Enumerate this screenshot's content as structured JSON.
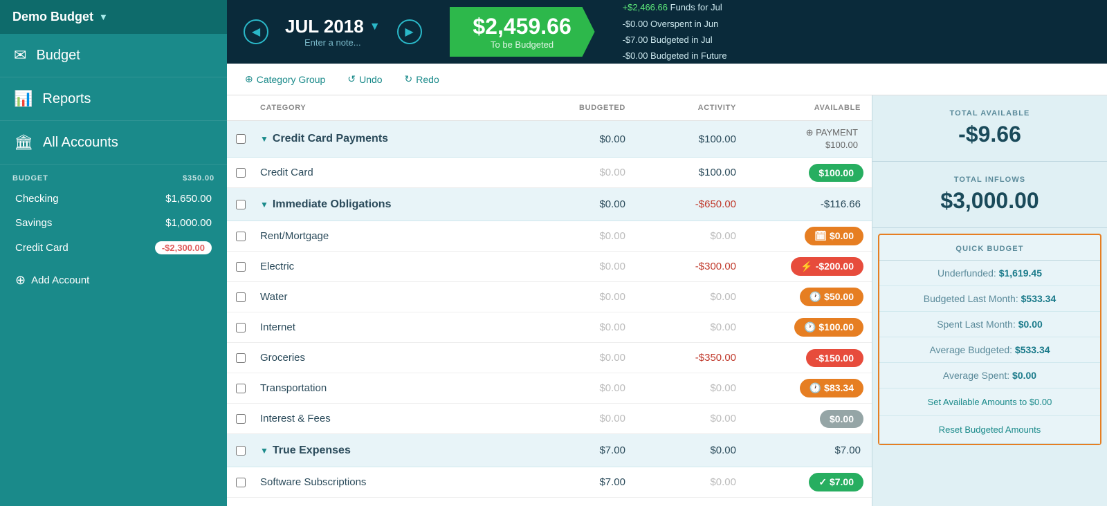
{
  "app": {
    "title": "Demo Budget",
    "title_arrow": "▼"
  },
  "sidebar": {
    "nav_items": [
      {
        "id": "budget",
        "icon": "✉",
        "label": "Budget"
      },
      {
        "id": "reports",
        "icon": "📊",
        "label": "Reports"
      },
      {
        "id": "all-accounts",
        "icon": "🏛",
        "label": "All Accounts"
      }
    ],
    "section_label": "BUDGET",
    "section_amount": "$350.00",
    "accounts": [
      {
        "name": "Checking",
        "amount": "$1,650.00",
        "negative": false
      },
      {
        "name": "Savings",
        "amount": "$1,000.00",
        "negative": false
      },
      {
        "name": "Credit Card",
        "amount": "-$2,300.00",
        "negative": true
      }
    ],
    "add_account_label": "Add Account"
  },
  "topbar": {
    "prev_label": "◀",
    "next_label": "▶",
    "month": "JUL 2018",
    "month_arrow": "▼",
    "month_note": "Enter a note...",
    "budget_value": "$2,459.66",
    "budget_label": "To be Budgeted",
    "info_lines": [
      {
        "prefix": "+",
        "amount": "$2,466.66",
        "label": "Funds for Jul"
      },
      {
        "prefix": "-",
        "amount": "$0.00",
        "label": "Overspent in Jun"
      },
      {
        "prefix": "-",
        "amount": "$7.00",
        "label": "Budgeted in Jul"
      },
      {
        "prefix": "-",
        "amount": "$0.00",
        "label": "Budgeted in Future"
      }
    ]
  },
  "toolbar": {
    "category_group_label": "Category Group",
    "undo_label": "Undo",
    "redo_label": "Redo"
  },
  "table": {
    "headers": [
      "CATEGORY",
      "BUDGETED",
      "ACTIVITY",
      "AVAILABLE"
    ],
    "groups": [
      {
        "id": "credit-card-payments",
        "name": "Credit Card Payments",
        "budgeted": "$0.00",
        "activity": "$100.00",
        "available_type": "payment",
        "available_label": "⊕ PAYMENT\n$100.00",
        "payment_line1": "⊕ PAYMENT",
        "payment_line2": "$100.00",
        "items": [
          {
            "name": "Credit Card",
            "budgeted": "$0.00",
            "activity": "$100.00",
            "available": "$100.00",
            "badge_color": "green"
          }
        ]
      },
      {
        "id": "immediate-obligations",
        "name": "Immediate Obligations",
        "budgeted": "$0.00",
        "activity": "-$650.00",
        "available": "-$116.66",
        "available_type": "text",
        "items": [
          {
            "name": "Rent/Mortgage",
            "budgeted": "$0.00",
            "activity": "$0.00",
            "available": "🗓 $0.00",
            "available_raw": "$0.00",
            "badge_color": "orange",
            "badge_icon": "🗓"
          },
          {
            "name": "Electric",
            "budgeted": "$0.00",
            "activity": "-$300.00",
            "available": "-$200.00",
            "badge_color": "red",
            "badge_icon": "⚡"
          },
          {
            "name": "Water",
            "budgeted": "$0.00",
            "activity": "$0.00",
            "available": "$50.00",
            "badge_color": "orange",
            "badge_icon": "🕐"
          },
          {
            "name": "Internet",
            "budgeted": "$0.00",
            "activity": "$0.00",
            "available": "$100.00",
            "badge_color": "orange",
            "badge_icon": "🕐"
          },
          {
            "name": "Groceries",
            "budgeted": "$0.00",
            "activity": "-$350.00",
            "available": "-$150.00",
            "badge_color": "red"
          },
          {
            "name": "Transportation",
            "budgeted": "$0.00",
            "activity": "$0.00",
            "available": "$83.34",
            "badge_color": "orange",
            "badge_icon": "🕐"
          },
          {
            "name": "Interest & Fees",
            "budgeted": "$0.00",
            "activity": "$0.00",
            "available": "$0.00",
            "badge_color": "gray"
          }
        ]
      },
      {
        "id": "true-expenses",
        "name": "True Expenses",
        "budgeted": "$7.00",
        "activity": "$0.00",
        "available": "$7.00",
        "available_type": "text",
        "items": [
          {
            "name": "Software Subscriptions",
            "budgeted": "$7.00",
            "activity": "$0.00",
            "available": "$7.00",
            "badge_color": "green",
            "badge_icon": "✓"
          }
        ]
      }
    ]
  },
  "right_panel": {
    "total_available_label": "TOTAL AVAILABLE",
    "total_available_value": "-$9.66",
    "total_inflows_label": "TOTAL INFLOWS",
    "total_inflows_value": "$3,000.00",
    "quick_budget_title": "QUICK BUDGET",
    "quick_budget_items": [
      {
        "label": "Underfunded:",
        "value": "$1,619.45"
      },
      {
        "label": "Budgeted Last Month:",
        "value": "$533.34"
      },
      {
        "label": "Spent Last Month:",
        "value": "$0.00"
      },
      {
        "label": "Average Budgeted:",
        "value": "$533.34"
      },
      {
        "label": "Average Spent:",
        "value": "$0.00"
      }
    ],
    "quick_budget_actions": [
      "Set Available Amounts to $0.00",
      "Reset Budgeted Amounts"
    ]
  }
}
